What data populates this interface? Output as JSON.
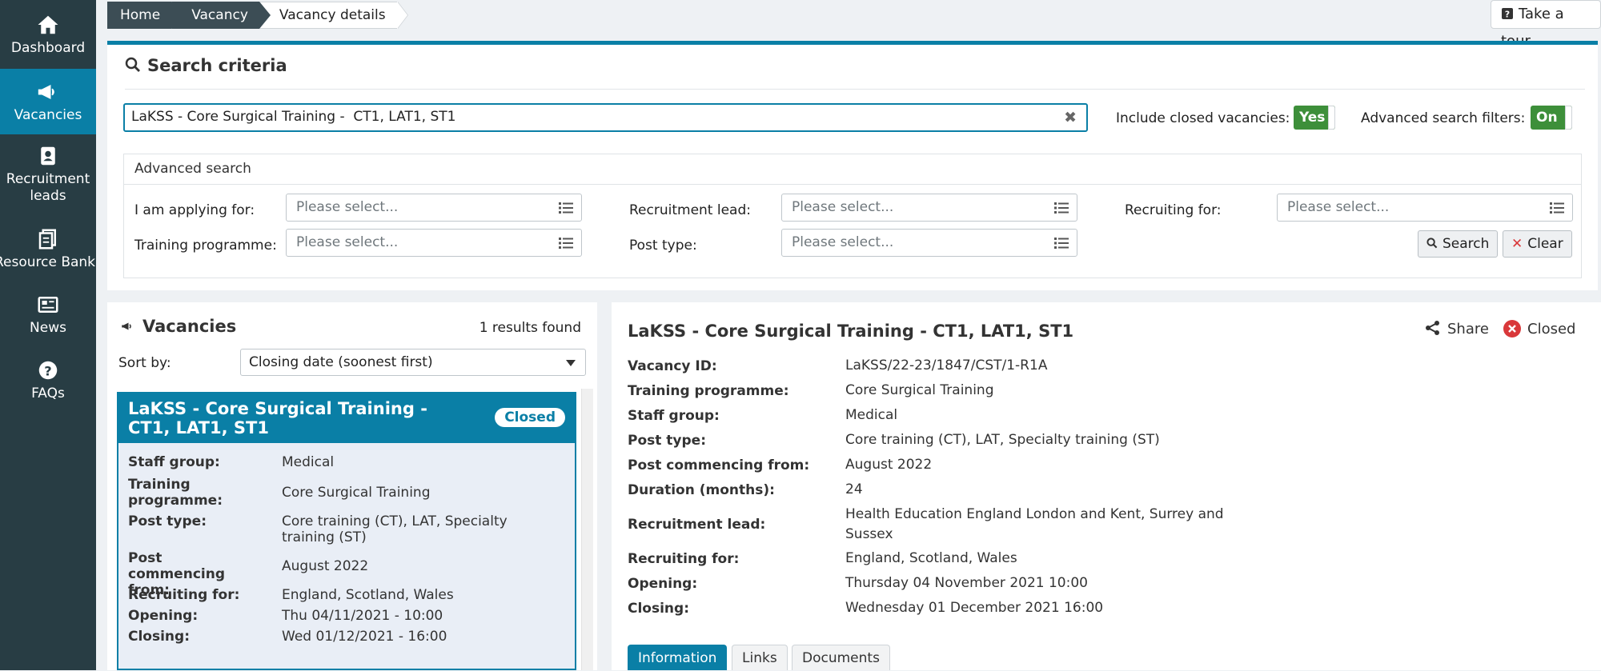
{
  "sidebar": {
    "items": [
      {
        "label": "Dashboard",
        "icon": "home-icon"
      },
      {
        "label": "Vacancies",
        "icon": "megaphone-icon"
      },
      {
        "label": "Recruitment leads",
        "icon": "contact-book-icon"
      },
      {
        "label": "Resource Bank",
        "icon": "documents-icon"
      },
      {
        "label": "News",
        "icon": "newspaper-icon"
      },
      {
        "label": "FAQs",
        "icon": "question-circle-icon"
      }
    ]
  },
  "breadcrumb": {
    "home": "Home",
    "vacancy": "Vacancy",
    "current": "Vacancy details"
  },
  "tour": {
    "label": "Take a tour"
  },
  "search": {
    "title": "Search criteria",
    "query": "LaKSS - Core Surgical Training -  CT1, LAT1, ST1",
    "include_closed_label": "Include closed vacancies:",
    "include_closed_value": "Yes",
    "advanced_label": "Advanced search filters:",
    "advanced_value": "On",
    "advanced_title": "Advanced search",
    "applying_label": "I am applying for:",
    "lead_label": "Recruitment lead:",
    "recruiting_label": "Recruiting for:",
    "programme_label": "Training programme:",
    "post_type_label": "Post type:",
    "placeholder": "Please select...",
    "search_button": "Search",
    "clear_button": "Clear"
  },
  "list": {
    "title": "Vacancies",
    "results": "1 results found",
    "sort_label": "Sort by:",
    "sort_value": "Closing date (soonest first)",
    "card": {
      "title": "LaKSS - Core Surgical Training - CT1, LAT1, ST1",
      "badge": "Closed",
      "rows": [
        {
          "k": "Staff group:",
          "v": "Medical"
        },
        {
          "k": "Training programme:",
          "v": "Core Surgical Training"
        },
        {
          "k": "Post type:",
          "v": "Core training (CT), LAT, Specialty training (ST)"
        },
        {
          "k": "Post commencing from:",
          "v": "August 2022"
        },
        {
          "k": "Recruiting for:",
          "v": "England, Scotland, Wales"
        },
        {
          "k": "Opening:",
          "v": "Thu 04/11/2021 - 10:00"
        },
        {
          "k": "Closing:",
          "v": "Wed 01/12/2021 - 16:00"
        }
      ]
    }
  },
  "detail": {
    "title": "LaKSS - Core Surgical Training - CT1, LAT1, ST1",
    "share": "Share",
    "status": "Closed",
    "rows": [
      {
        "k": "Vacancy ID:",
        "v": "LaKSS/22-23/1847/CST/1-R1A"
      },
      {
        "k": "Training programme:",
        "v": "Core Surgical Training"
      },
      {
        "k": "Staff group:",
        "v": "Medical"
      },
      {
        "k": "Post type:",
        "v": "Core training (CT), LAT, Specialty training (ST)"
      },
      {
        "k": "Post commencing from:",
        "v": "August 2022"
      },
      {
        "k": "Duration (months):",
        "v": "24"
      },
      {
        "k": "Recruitment lead:",
        "v": "Health Education England London and Kent, Surrey and Sussex"
      },
      {
        "k": "Recruiting for:",
        "v": "England, Scotland, Wales"
      },
      {
        "k": "Opening:",
        "v": "Thursday 04 November 2021 10:00"
      },
      {
        "k": "Closing:",
        "v": "Wednesday 01 December 2021 16:00"
      }
    ],
    "tabs": [
      "Information",
      "Links",
      "Documents"
    ]
  },
  "colors": {
    "accent": "#0a7fa6",
    "sidebar": "#283d44",
    "toggle_on": "#3d8f3a",
    "closed_red": "#d9383a"
  }
}
